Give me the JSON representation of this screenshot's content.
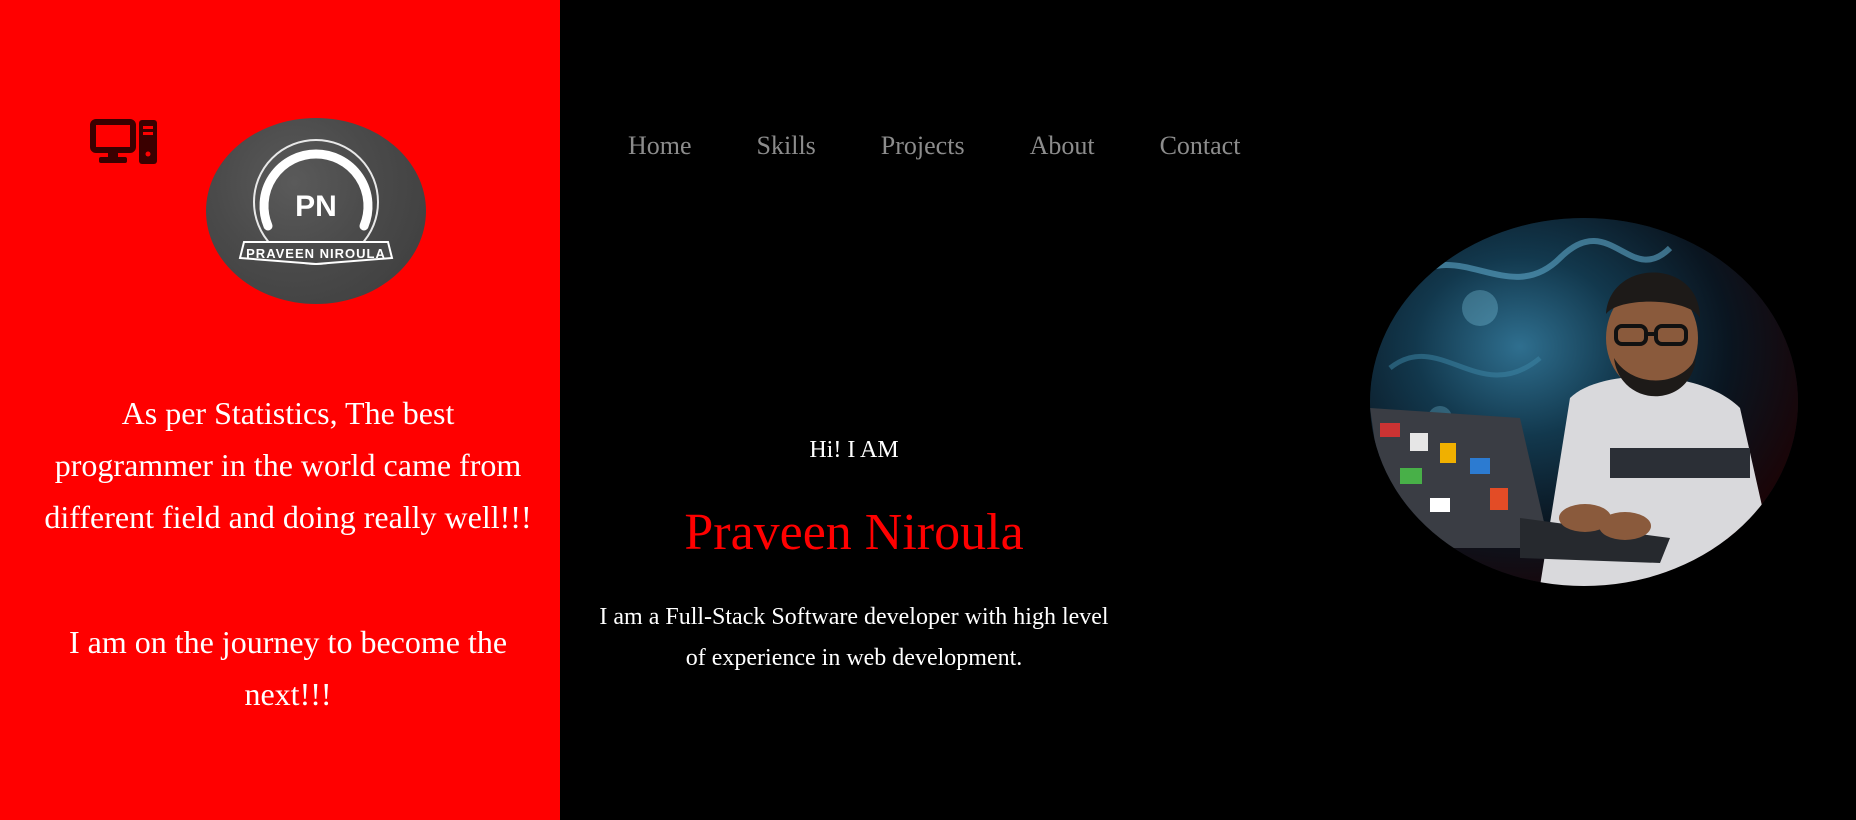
{
  "sidebar": {
    "logo_text_initials": "PN",
    "logo_text_name": "PRAVEEN NIROULA",
    "paragraph_1": "As per Statistics, The best programmer in the world came from different field and doing really well!!!",
    "paragraph_2": "I am on the journey to become the next!!!",
    "icon": "desktop-computer-icon"
  },
  "nav": {
    "items": [
      {
        "label": "Home"
      },
      {
        "label": "Skills"
      },
      {
        "label": "Projects"
      },
      {
        "label": "About"
      },
      {
        "label": "Contact"
      }
    ]
  },
  "hero": {
    "greeting": "Hi! I AM",
    "name": "Praveen Niroula",
    "description": "I am a Full-Stack Software developer with high level of experience in web development."
  },
  "colors": {
    "accent_red": "#ff0000",
    "background": "#000000",
    "nav_text": "#8c8c8c",
    "text": "#ffffff"
  }
}
